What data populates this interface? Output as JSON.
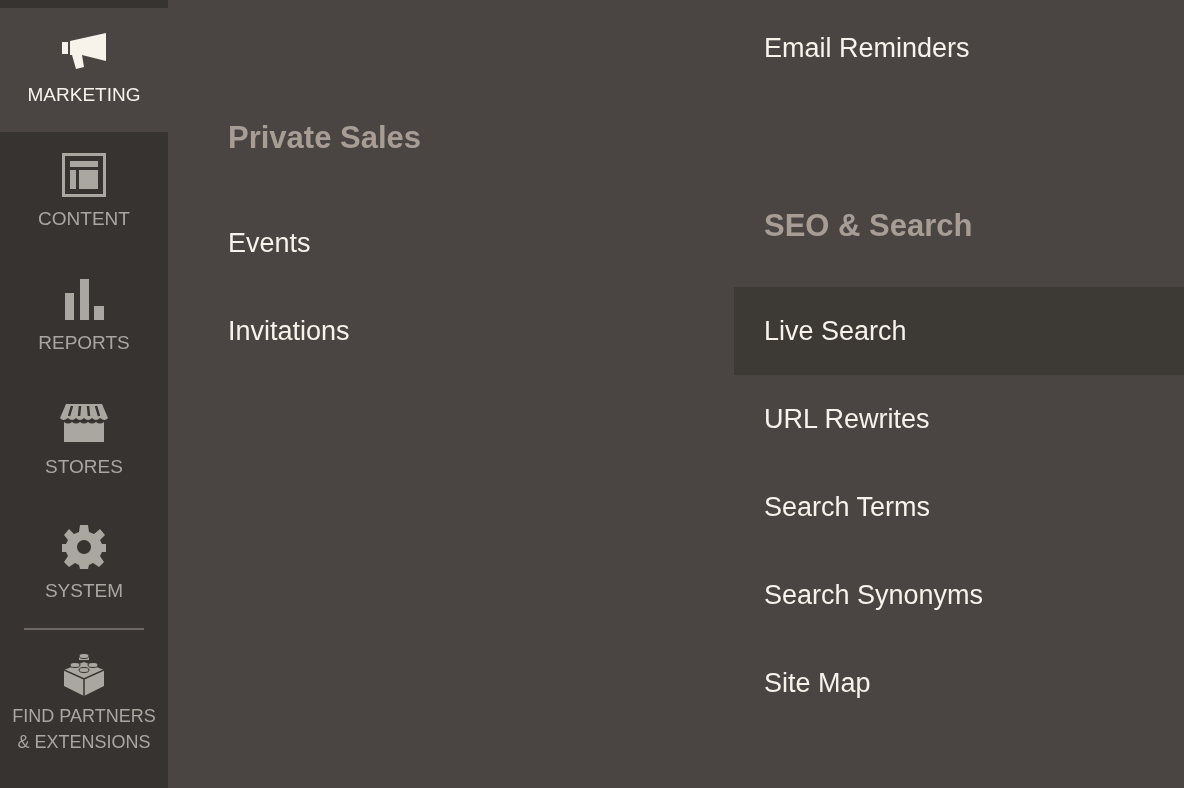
{
  "sidebar": {
    "items": [
      {
        "label": "MARKETING",
        "selected": true
      },
      {
        "label": "CONTENT",
        "selected": false
      },
      {
        "label": "REPORTS",
        "selected": false
      },
      {
        "label": "STORES",
        "selected": false
      },
      {
        "label": "SYSTEM",
        "selected": false
      }
    ],
    "partners_link": {
      "label": "FIND PARTNERS & EXTENSIONS"
    }
  },
  "submenu": {
    "columns": [
      {
        "groups": [
          {
            "title": "Private Sales",
            "items": [
              {
                "label": "Events",
                "selected": false
              },
              {
                "label": "Invitations",
                "selected": false
              }
            ]
          }
        ]
      },
      {
        "groups": [
          {
            "items": [
              {
                "label": "Email Reminders",
                "selected": false
              }
            ]
          },
          {
            "title": "SEO & Search",
            "items": [
              {
                "label": "Live Search",
                "selected": true
              },
              {
                "label": "URL Rewrites",
                "selected": false
              },
              {
                "label": "Search Terms",
                "selected": false
              },
              {
                "label": "Search Synonyms",
                "selected": false
              },
              {
                "label": "Site Map",
                "selected": false
              }
            ]
          }
        ]
      }
    ]
  }
}
